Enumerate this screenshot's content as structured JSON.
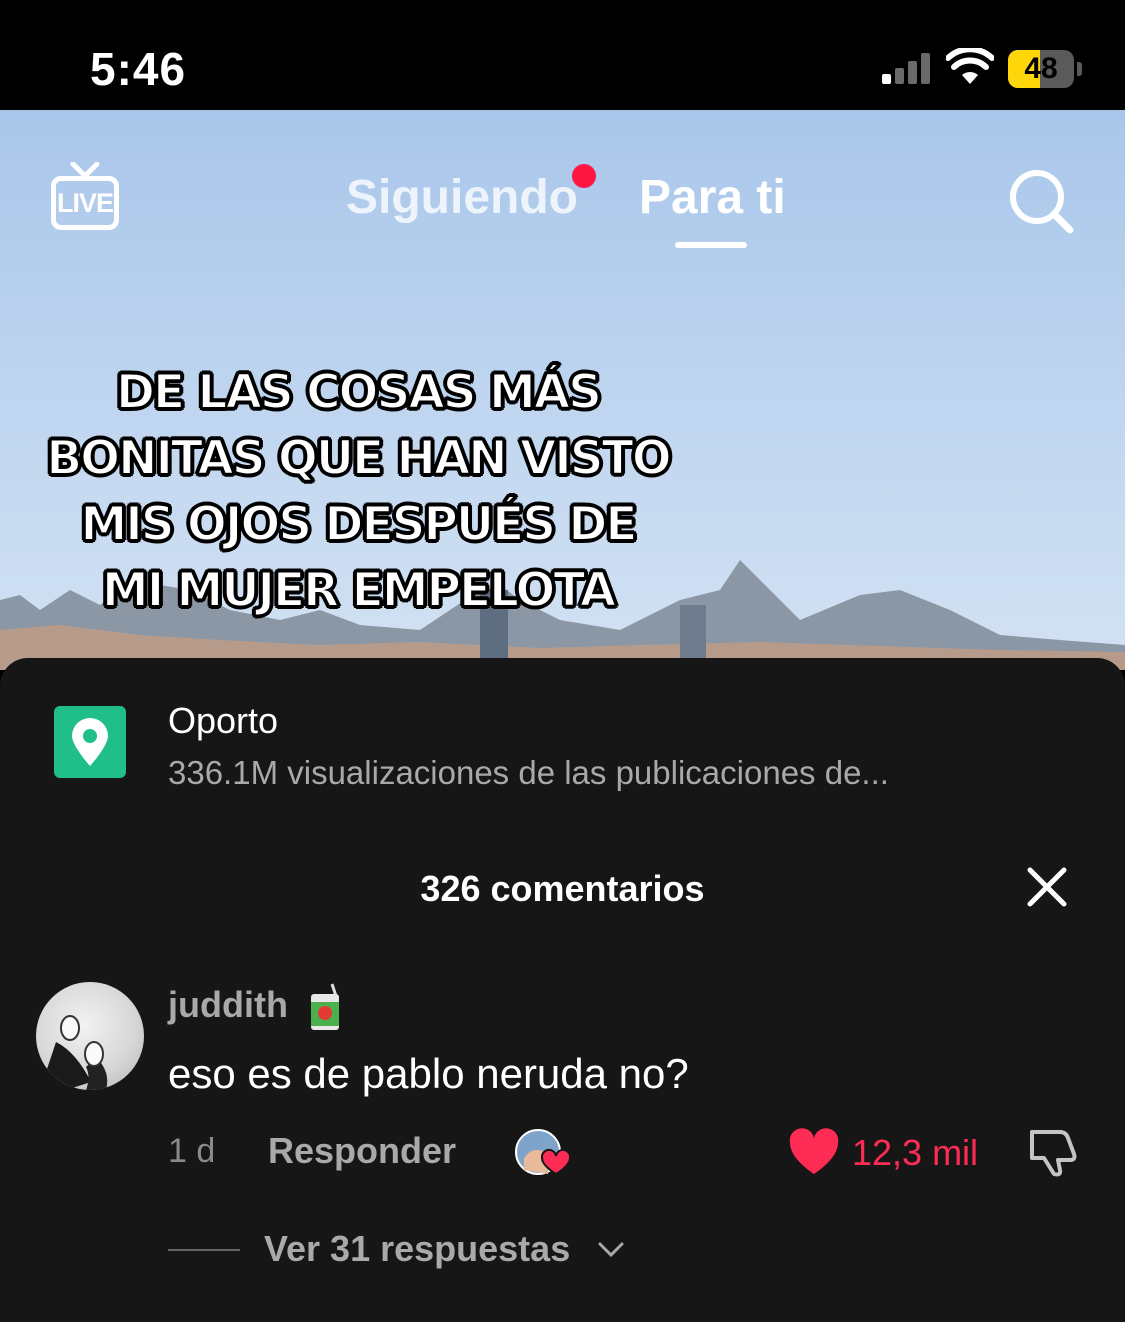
{
  "status_bar": {
    "time": "5:46",
    "battery": "48",
    "battery_level": 0.48
  },
  "top_nav": {
    "live_label": "LIVE",
    "tabs": [
      {
        "label": "Siguiendo",
        "active": false,
        "has_notification_dot": true
      },
      {
        "label": "Para ti",
        "active": true
      }
    ],
    "icons": [
      "live-icon",
      "search-icon"
    ]
  },
  "video": {
    "caption_lines": [
      "DE LAS COSAS MÁS",
      "BONITAS QUE HAN VISTO",
      "MIS OJOS DESPUÉS DE",
      "MI MUJER EMPELOTA"
    ]
  },
  "location": {
    "name": "Oporto",
    "subtitle": "336.1M visualizaciones de las publicaciones de...",
    "icon": "location-pin-icon",
    "color": "#20be88"
  },
  "comments": {
    "count_label": "326 comentarios",
    "items": [
      {
        "username": "juddith",
        "username_emoji": "juice-box-icon",
        "text": "eso es de pablo neruda no?",
        "time": "1 d",
        "reply_label": "Responder",
        "likes": "12,3 mil",
        "liked": true,
        "liked_by_creator": true,
        "view_replies_label": "Ver 31 respuestas"
      }
    ]
  },
  "colors": {
    "accent": "#fe2c55",
    "sheet_bg": "#161616",
    "notification_dot": "#ff1744"
  }
}
